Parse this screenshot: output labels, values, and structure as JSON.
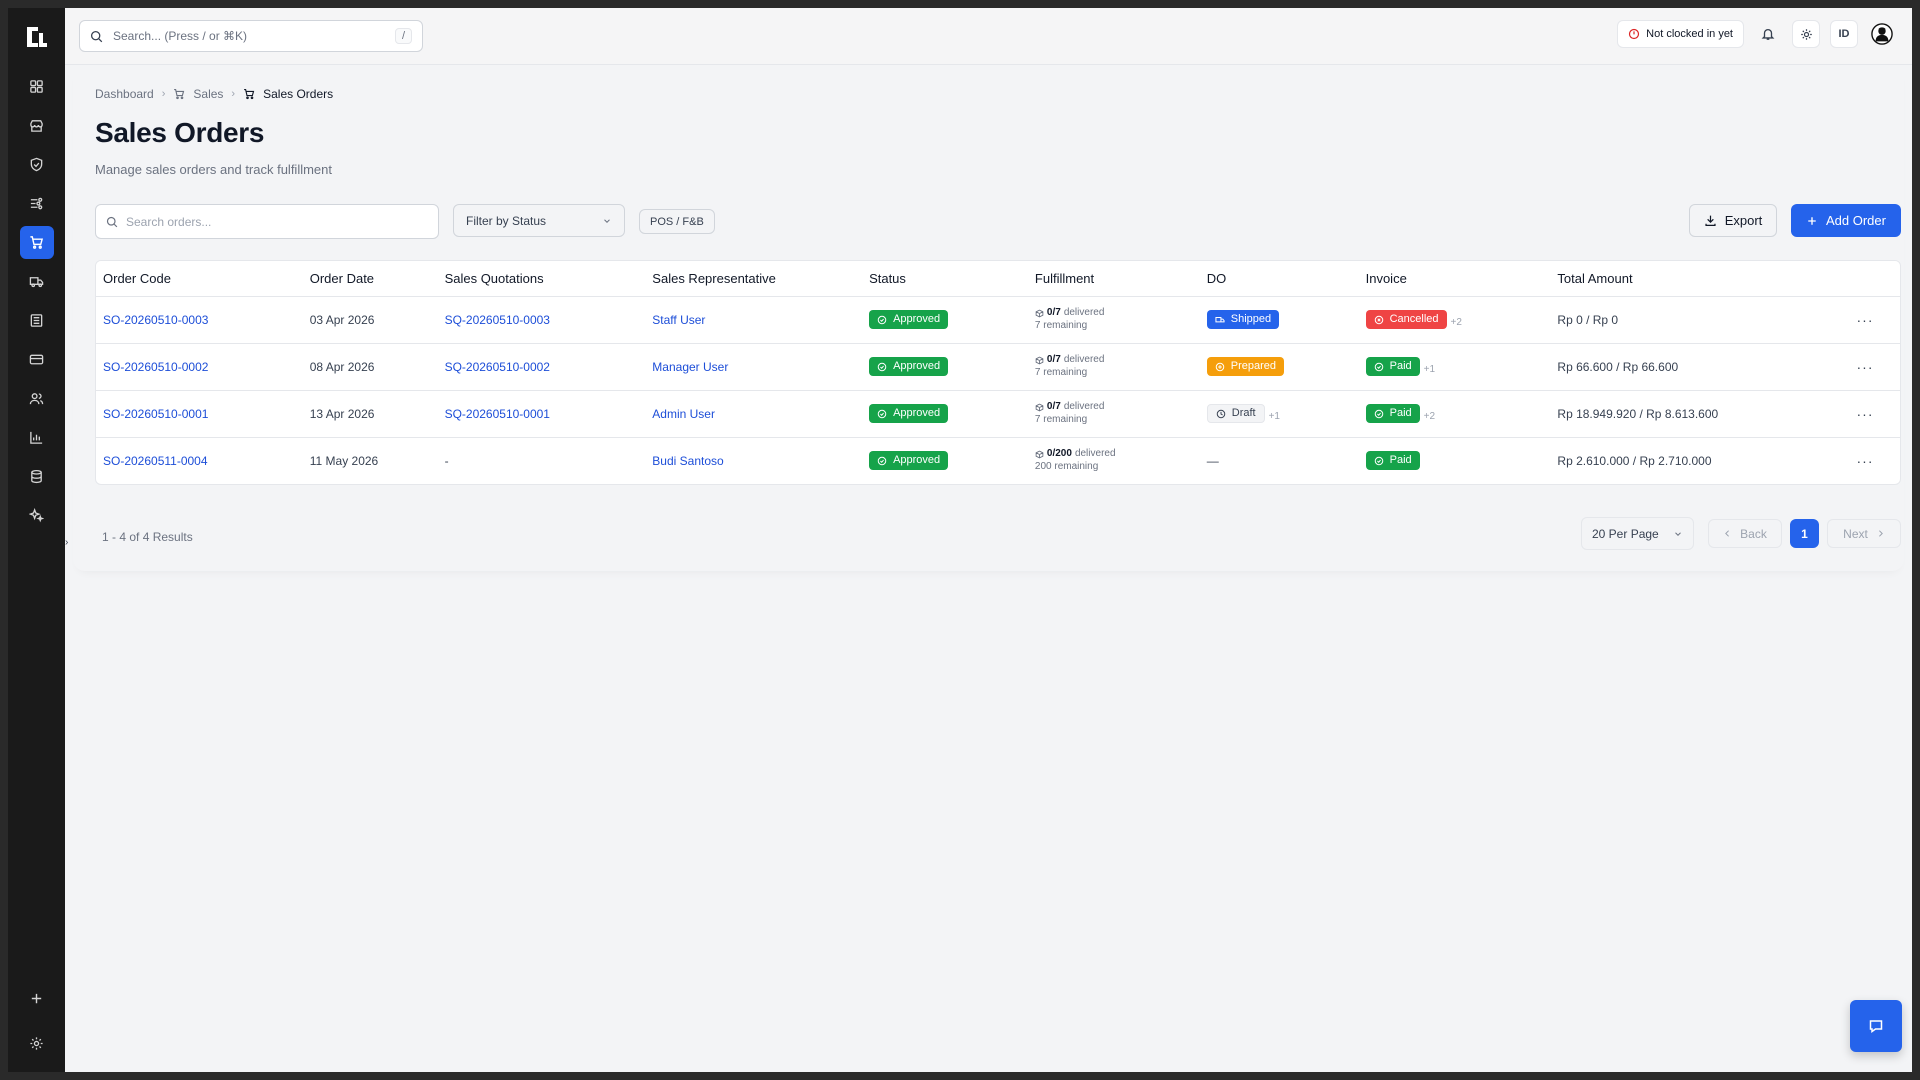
{
  "search": {
    "placeholder": "Search... (Press / or ⌘K)",
    "shortcut": "/"
  },
  "topbar": {
    "clock_status": "Not clocked in yet",
    "language": "ID"
  },
  "sidebar": {
    "items": [
      {
        "icon": "dashboard-icon"
      },
      {
        "icon": "store-icon"
      },
      {
        "icon": "shield-icon"
      },
      {
        "icon": "inventory-icon"
      },
      {
        "icon": "cart-icon",
        "active": true
      },
      {
        "icon": "truck-icon"
      },
      {
        "icon": "building-icon"
      },
      {
        "icon": "card-icon"
      },
      {
        "icon": "users-icon"
      },
      {
        "icon": "chart-icon"
      },
      {
        "icon": "database-icon"
      },
      {
        "icon": "sparkle-icon"
      }
    ]
  },
  "breadcrumb": {
    "home": "Dashboard",
    "section": "Sales",
    "current": "Sales Orders"
  },
  "page": {
    "title": "Sales Orders",
    "subtitle": "Manage sales orders and track fulfillment"
  },
  "toolbar": {
    "search_placeholder": "Search orders...",
    "filter_label": "Filter by Status",
    "pos_label": "POS / F&B",
    "export_label": "Export",
    "add_label": "Add Order"
  },
  "table": {
    "headers": [
      "Order Code",
      "Order Date",
      "Sales Quotations",
      "Sales Representative",
      "Status",
      "Fulfillment",
      "DO",
      "Invoice",
      "Total Amount"
    ],
    "rows": [
      {
        "code": "SO-20260510-0003",
        "date": "03 Apr 2026",
        "quotation": "SQ-20260510-0003",
        "rep": "Staff User",
        "status": "Approved",
        "ful_count": "0/7",
        "ful_word": "delivered",
        "ful_remaining": "7 remaining",
        "do": "Shipped",
        "do_extra": "",
        "invoice": "Cancelled",
        "invoice_extra": "+2",
        "total": "Rp 0 / Rp 0"
      },
      {
        "code": "SO-20260510-0002",
        "date": "08 Apr 2026",
        "quotation": "SQ-20260510-0002",
        "rep": "Manager User",
        "status": "Approved",
        "ful_count": "0/7",
        "ful_word": "delivered",
        "ful_remaining": "7 remaining",
        "do": "Prepared",
        "do_extra": "",
        "invoice": "Paid",
        "invoice_extra": "+1",
        "total": "Rp 66.600 / Rp 66.600"
      },
      {
        "code": "SO-20260510-0001",
        "date": "13 Apr 2026",
        "quotation": "SQ-20260510-0001",
        "rep": "Admin User",
        "status": "Approved",
        "ful_count": "0/7",
        "ful_word": "delivered",
        "ful_remaining": "7 remaining",
        "do": "Draft",
        "do_extra": "+1",
        "invoice": "Paid",
        "invoice_extra": "+2",
        "total": "Rp 18.949.920 / Rp 8.613.600"
      },
      {
        "code": "SO-20260511-0004",
        "date": "11 May 2026",
        "quotation": "-",
        "rep": "Budi Santoso",
        "status": "Approved",
        "ful_count": "0/200",
        "ful_word": "delivered",
        "ful_remaining": "200 remaining",
        "do": "—",
        "do_extra": "",
        "invoice": "Paid",
        "invoice_extra": "",
        "total": "Rp 2.610.000 / Rp 2.710.000"
      }
    ]
  },
  "pagination": {
    "results": "1 - 4 of 4 Results",
    "per_page": "20 Per Page",
    "back": "Back",
    "page": "1",
    "next": "Next"
  },
  "colors": {
    "accent": "#2563eb",
    "approved": "#16a34a",
    "prepared": "#f59e0b",
    "cancelled": "#ef4444"
  }
}
